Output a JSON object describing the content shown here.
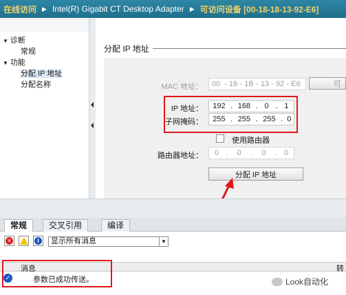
{
  "titlebar": {
    "seg1": "在线访问",
    "seg2": "Intel(R) Gigabit CT Desktop Adapter",
    "seg3": "可访问设备 [00-18-18-13-92-E6]"
  },
  "tree": {
    "diag": "诊断",
    "diag_general": "常规",
    "func": "功能",
    "assign_ip": "分配 IP 地址",
    "assign_name": "分配名称"
  },
  "section": {
    "title": "分配 IP 地址"
  },
  "form": {
    "mac_label": "MAC 地址：",
    "mac_value": [
      "00",
      "18",
      "1B",
      "13",
      "92",
      "E6"
    ],
    "mac_button": "可",
    "ip_label": "IP 地址：",
    "ip_value": [
      "192",
      "168",
      "0",
      "1"
    ],
    "mask_label": "子网掩码：",
    "mask_value": [
      "255",
      "255",
      "255",
      "0"
    ],
    "router_check_label": "使用路由器",
    "router_label": "路由器地址：",
    "router_value": [
      "0",
      "0",
      "0",
      "0"
    ],
    "assign_button": "分配 IP 地址"
  },
  "bottom_tabs": [
    "常规",
    "交叉引用",
    "编译"
  ],
  "filter": {
    "selected": "显示所有消息"
  },
  "messages": {
    "col_msg": "消息",
    "col_right": "转",
    "row_text": "参数已成功传送。"
  },
  "watermark": "Look自动化",
  "colors": {
    "accent_red": "#e0161b",
    "titlebar": "#2e86a5"
  }
}
